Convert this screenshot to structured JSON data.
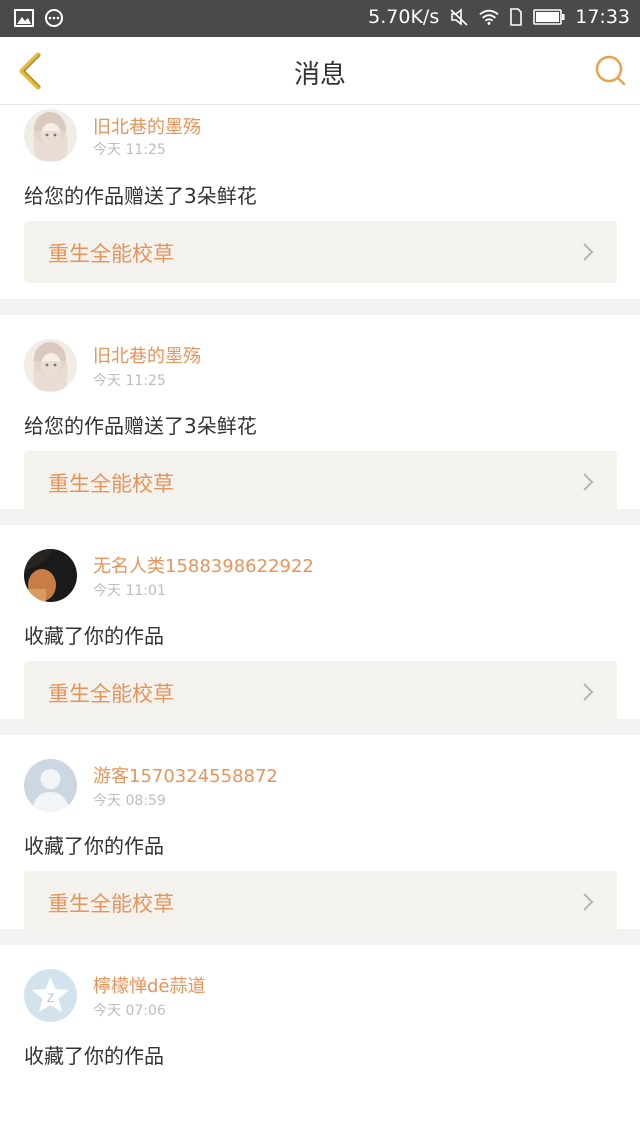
{
  "status_bar": {
    "network_speed": "5.70K/s",
    "time": "17:33",
    "icons": [
      "image-icon",
      "chat-icon",
      "mute-icon",
      "wifi-icon",
      "sim-icon",
      "battery-icon"
    ]
  },
  "nav": {
    "title": "消息",
    "back_icon": "chevron-left-icon",
    "search_icon": "search-icon",
    "accent": "#e8b93a"
  },
  "colors": {
    "accent_text": "#e8935a",
    "card_link_bg": "#f3f2ec"
  },
  "messages": [
    {
      "user": "旧北巷的墨殇",
      "time": "今天 11:25",
      "action": "给您的作品赠送了3朵鲜花",
      "work": "重生全能校草",
      "avatar": "anime-girl-avatar"
    },
    {
      "user": "旧北巷的墨殇",
      "time": "今天 11:25",
      "action": "给您的作品赠送了3朵鲜花",
      "work": "重生全能校草",
      "avatar": "anime-girl-avatar"
    },
    {
      "user": "无名人类1588398622922",
      "time": "今天 11:01",
      "action": "收藏了你的作品",
      "work": "重生全能校草",
      "avatar": "photo-avatar"
    },
    {
      "user": "游客1570324558872",
      "time": "今天 08:59",
      "action": "收藏了你的作品",
      "work": "重生全能校草",
      "avatar": "default-person-avatar"
    },
    {
      "user": "檸檬惮dē蒜道",
      "time": "今天 07:06",
      "action": "收藏了你的作品",
      "work": "",
      "avatar": "qzone-star-avatar"
    }
  ]
}
